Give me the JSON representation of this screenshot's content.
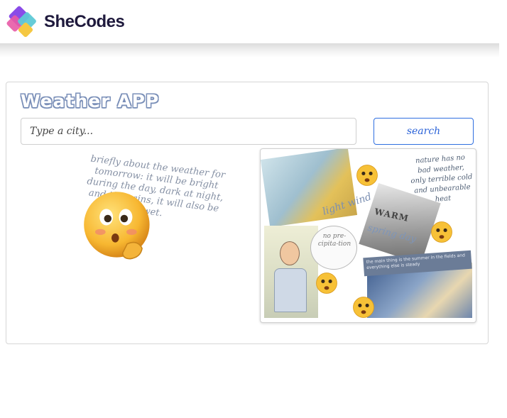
{
  "header": {
    "brand": "SheCodes",
    "logo_colors": [
      "#8a4be8",
      "#5ec9d6",
      "#e85aa6",
      "#f5c842"
    ]
  },
  "app": {
    "title": "Weather APP",
    "search": {
      "placeholder": "Type a city...",
      "value": "",
      "button_label": "search"
    },
    "forecast_text": "briefly about the weather for tomorrow: it will be bright during the day, dark at night, and if it rains, it will also be wet.",
    "collage": {
      "quote": "nature has no bad weather, only terrible cold and unbearable heat",
      "light_wind": "light wind",
      "warm": "WARM",
      "spring": "spring day",
      "no_precipitation": "no pre-cipita-tion",
      "banner": "the main thing is the summer in the fields and everything else is steady"
    }
  },
  "colors": {
    "accent": "#2f6fe0",
    "title_outline": "#7a8fb8",
    "muted_text": "#8590a4"
  },
  "icons": [
    "shecodes-logo-icon",
    "thinking-emoji-icon",
    "worried-emoji-icon"
  ]
}
